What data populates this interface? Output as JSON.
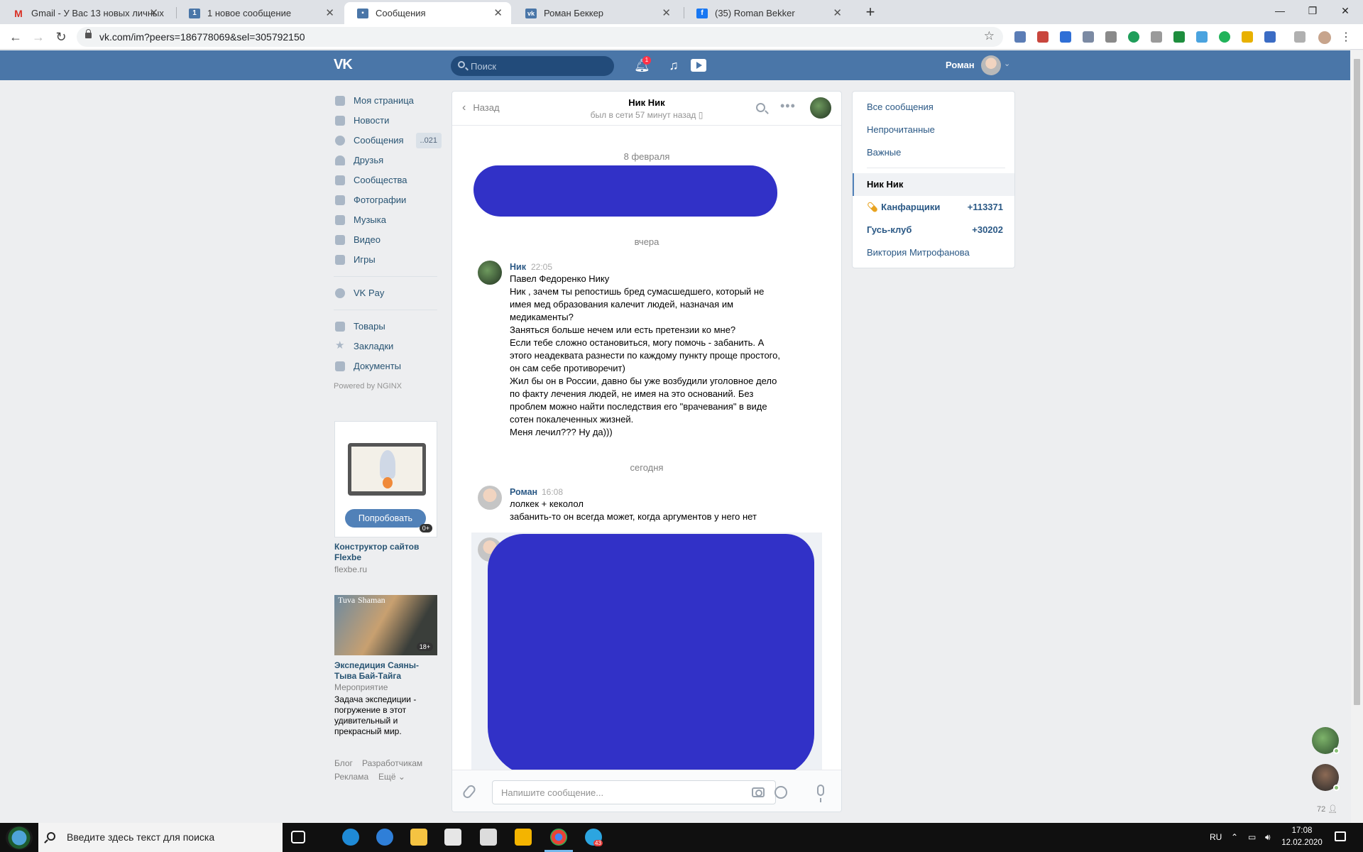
{
  "browser": {
    "tabs": [
      {
        "title": "Gmail - У Вас 13 новых личных"
      },
      {
        "title": "1 новое сообщение"
      },
      {
        "title": "Сообщения"
      },
      {
        "title": "Роман Беккер"
      },
      {
        "title": "(35) Roman Bekker"
      }
    ],
    "favicons": {
      "gmail": "M",
      "vk_count": "1"
    },
    "url": "vk.com/im?peers=186778069&sel=305792150"
  },
  "vk_header": {
    "search_placeholder": "Поиск",
    "notification_count": "1",
    "username": "Роман",
    "logo_text": "VK"
  },
  "left_nav": {
    "items": [
      {
        "label": "Моя страница",
        "icon": "home-icon"
      },
      {
        "label": "Новости",
        "icon": "news-icon"
      },
      {
        "label": "Сообщения",
        "icon": "messages-icon",
        "count": "..021"
      },
      {
        "label": "Друзья",
        "icon": "friends-icon"
      },
      {
        "label": "Сообщества",
        "icon": "communities-icon"
      },
      {
        "label": "Фотографии",
        "icon": "camera-icon"
      },
      {
        "label": "Музыка",
        "icon": "music-icon"
      },
      {
        "label": "Видео",
        "icon": "video-icon"
      },
      {
        "label": "Игры",
        "icon": "games-icon"
      }
    ],
    "vkpay": "VK Pay",
    "items2": [
      {
        "label": "Товары",
        "icon": "bag-icon"
      },
      {
        "label": "Закладки",
        "icon": "star-icon"
      },
      {
        "label": "Документы",
        "icon": "document-icon"
      }
    ],
    "powered": "Powered by NGINX"
  },
  "ads": {
    "ad1": {
      "button": "Попробовать",
      "age": "0+",
      "title": "Конструктор сайтов Flexbe",
      "domain": "flexbe.ru"
    },
    "ad2": {
      "image_text_left": "Tuva",
      "image_text_right": "Shaman",
      "age": "18+",
      "title": "Экспедиция Саяны-Тыва Бай-Тайга",
      "type": "Мероприятие",
      "desc": "Задача экспедиции - погружение в этот удивительный и прекрасный мир."
    }
  },
  "footer": {
    "blog": "Блог",
    "devs": "Разработчикам",
    "ads": "Реклама",
    "more": "Ещё"
  },
  "chat": {
    "back": "Назад",
    "peer_name": "Ник Ник",
    "peer_status": "был в сети 57 минут назад",
    "date1": "8 февраля",
    "date2": "вчера",
    "date3": "сегодня",
    "messages": [
      {
        "author": "Ник",
        "time": "22:05",
        "lines": [
          "Павел Федоренко Нику",
          "Ник , зачем ты репостишь бред сумасшедшего, который не имея мед образования калечит людей, назначая им медикаменты?",
          "Заняться больше нечем или есть претензии ко мне?",
          "Если тебе сложно остановиться, могу помочь - забанить. А этого неадеквата разнести по каждому пункту проще простого, он сам себе противоречит)",
          "Жил бы он в России, давно бы уже возбудили уголовное дело по факту лечения людей, не имея на это оснований. Без проблем можно найти последствия его \"врачевания\" в виде сотен покалеченных жизней.",
          "Меня лечил??? Ну да)))"
        ]
      },
      {
        "author": "Роман",
        "time": "16:08",
        "lines": [
          "лолкек + кеколол",
          "забанить-то он всегда может, когда аргументов у него нет"
        ]
      }
    ],
    "composer_placeholder": "Напишите сообщение..."
  },
  "right_panel": {
    "filters": [
      "Все сообщения",
      "Непрочитанные",
      "Важные"
    ],
    "conversations": [
      {
        "name": "Ник Ник",
        "count": ""
      },
      {
        "name": "Канфарщики",
        "count": "+113371"
      },
      {
        "name": "Гусь-клуб",
        "count": "+30202"
      },
      {
        "name": "Виктория Митрофанова",
        "count": ""
      }
    ]
  },
  "online_count": "72",
  "taskbar": {
    "search_placeholder": "Введите здесь текст для поиска",
    "telegram_badge": "43",
    "lang": "RU",
    "time": "17:08",
    "date": "12.02.2020"
  },
  "colors": {
    "vk_blue": "#4a76a8",
    "link": "#2a5885",
    "scribble": "#3131c7"
  }
}
